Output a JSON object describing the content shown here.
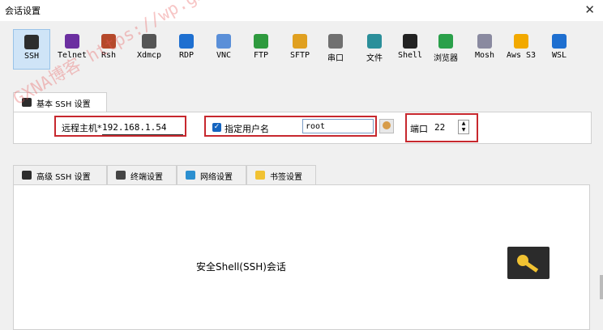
{
  "window": {
    "title": "会话设置",
    "close_label": "✕"
  },
  "toolbar": {
    "items": [
      {
        "label": "SSH",
        "icon": "wrench-icon",
        "color": "#2d2d2d",
        "active": true
      },
      {
        "label": "Telnet",
        "icon": "telnet-icon",
        "color": "#6b2fa0"
      },
      {
        "label": "Rsh",
        "icon": "rsh-icon",
        "color": "#b5482a"
      },
      {
        "label": "Xdmcp",
        "icon": "xdmcp-icon",
        "color": "#555555"
      },
      {
        "label": "RDP",
        "icon": "rdp-icon",
        "color": "#1e6fd0"
      },
      {
        "label": "VNC",
        "icon": "vnc-icon",
        "color": "#5a8fd8"
      },
      {
        "label": "FTP",
        "icon": "ftp-icon",
        "color": "#2e9a3e"
      },
      {
        "label": "SFTP",
        "icon": "sftp-icon",
        "color": "#e0a020"
      },
      {
        "label": "串口",
        "icon": "serial-icon",
        "color": "#707070"
      },
      {
        "label": "文件",
        "icon": "file-icon",
        "color": "#2b8f9a"
      },
      {
        "label": "Shell",
        "icon": "shell-icon",
        "color": "#222222"
      },
      {
        "label": "浏览器",
        "icon": "browser-icon",
        "color": "#2aa04a"
      },
      {
        "label": "Mosh",
        "icon": "mosh-icon",
        "color": "#8a8aa0"
      },
      {
        "label": "Aws S3",
        "icon": "aws-icon",
        "color": "#f2a900"
      },
      {
        "label": "WSL",
        "icon": "wsl-icon",
        "color": "#1e6fd0"
      }
    ]
  },
  "basic": {
    "tab_label": "基本 SSH 设置",
    "remote_host_label": "远程主机*",
    "remote_host_value": "192.168.1.54",
    "specify_user_label": "指定用户名",
    "user_value": "root",
    "port_label": "端口",
    "port_value": "22",
    "highlight_color": "#c7282e"
  },
  "tabs": [
    {
      "label": "高级 SSH 设置",
      "icon": "wrench-icon",
      "color": "#2d2d2d"
    },
    {
      "label": "终端设置",
      "icon": "terminal-icon",
      "color": "#444444"
    },
    {
      "label": "网络设置",
      "icon": "network-icon",
      "color": "#2b8fd0"
    },
    {
      "label": "书签设置",
      "icon": "star-icon",
      "color": "#f1c232"
    }
  ],
  "session": {
    "description": "安全Shell(SSH)会话"
  },
  "watermark": {
    "text": "GXNA博客 https://wp.gxnas.com"
  }
}
